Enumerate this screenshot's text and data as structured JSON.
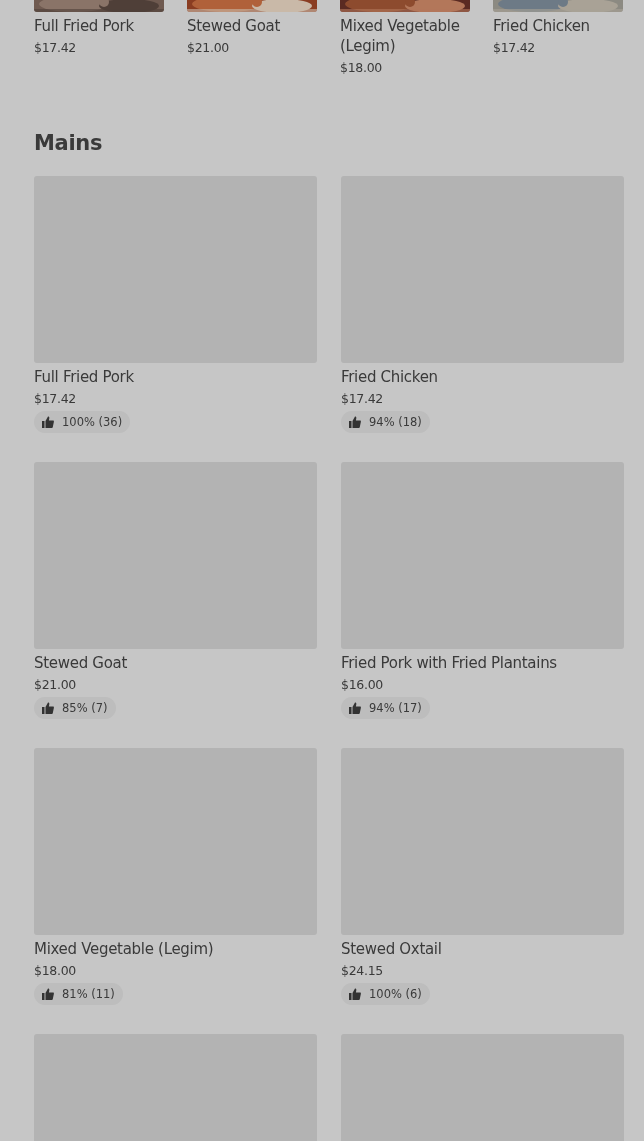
{
  "carousel": [
    {
      "name": "Full Fried Pork",
      "price": "$17.42",
      "kind": "picture"
    },
    {
      "name": "Stewed Goat",
      "price": "$21.00",
      "kind": "picture"
    },
    {
      "name": "Mixed Vegetable (Legim)",
      "price": "$18.00",
      "kind": "picture"
    },
    {
      "name": "Fried Chicken",
      "price": "$17.42",
      "kind": "picture"
    }
  ],
  "mains": {
    "title": "Mains",
    "items": [
      {
        "kind": "dish",
        "name": "Full Fried Pork",
        "price": "$17.42",
        "rating": "100% (36)"
      },
      {
        "kind": "dish",
        "name": "Fried Chicken",
        "price": "$17.42",
        "rating": "94% (18)"
      },
      {
        "kind": "dish",
        "name": "Stewed Goat",
        "price": "$21.00",
        "rating": "85% (7)"
      },
      {
        "kind": "dish",
        "name": "Fried Pork with Fried Plantains",
        "price": "$16.00",
        "rating": "94% (17)"
      },
      {
        "kind": "dish",
        "name": "Mixed Vegetable (Legim)",
        "price": "$18.00",
        "rating": "81% (11)"
      },
      {
        "kind": "dish",
        "name": "Stewed Oxtail",
        "price": "$24.15",
        "rating": "100% (6)"
      },
      {
        "kind": "placeholder"
      },
      {
        "kind": "placeholder"
      }
    ]
  }
}
